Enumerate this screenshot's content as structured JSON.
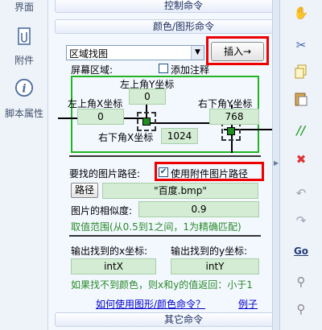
{
  "leftnav": {
    "items": [
      {
        "label": "界面"
      },
      {
        "label": "附件"
      },
      {
        "label": "脚本属性"
      }
    ]
  },
  "sections": {
    "control": "控制命令",
    "color_image": "颜色/图形命令",
    "other": "其它命令"
  },
  "command": {
    "select_value": "区域找图",
    "insert_button": "插入→"
  },
  "region": {
    "label": "屏幕区域:",
    "add_comment": "添加注释",
    "top_left_y_label": "左上角Y坐标",
    "top_left_y_value": "0",
    "top_left_x_label": "左上角X坐标",
    "top_left_x_value": "0",
    "bottom_right_y_label": "右下角Y坐标",
    "bottom_right_y_value": "768",
    "bottom_right_x_label": "右下角X坐标",
    "bottom_right_x_value": "1024"
  },
  "image": {
    "path_label": "要找的图片路径:",
    "use_attachment_label": "使用附件图片路径",
    "use_attachment_checked": true,
    "path_button": "路径",
    "path_value": "\"百度.bmp\"",
    "similarity_label": "图片的相似度:",
    "similarity_value": "0.9",
    "range_hint": "取值范围(从0.5到1之间，1为精确匹配)"
  },
  "output": {
    "x_label": "输出找到的x坐标:",
    "y_label": "输出找到的y坐标:",
    "x_value": "intX",
    "y_value": "intY",
    "notfound_hint": "如果找不到颜色，则x和y的值返回：小于1"
  },
  "links": {
    "howto": "如何使用图形/颜色命令？",
    "example": "例子"
  },
  "toolbar": {
    "icons": [
      "hand-icon",
      "scissors-icon",
      "copy-icon",
      "paste-icon",
      "comment-icon",
      "uncomment-icon",
      "undo-icon",
      "redo-icon",
      "goto-icon",
      "find-icon",
      "find-next-icon"
    ],
    "goto_label": "Go"
  },
  "colors": {
    "accent_red": "#ee0000",
    "field_green": "#d3ecd3",
    "region_border": "#22b422",
    "hint_green": "#2a8a2a",
    "link_blue": "#0000cc"
  }
}
